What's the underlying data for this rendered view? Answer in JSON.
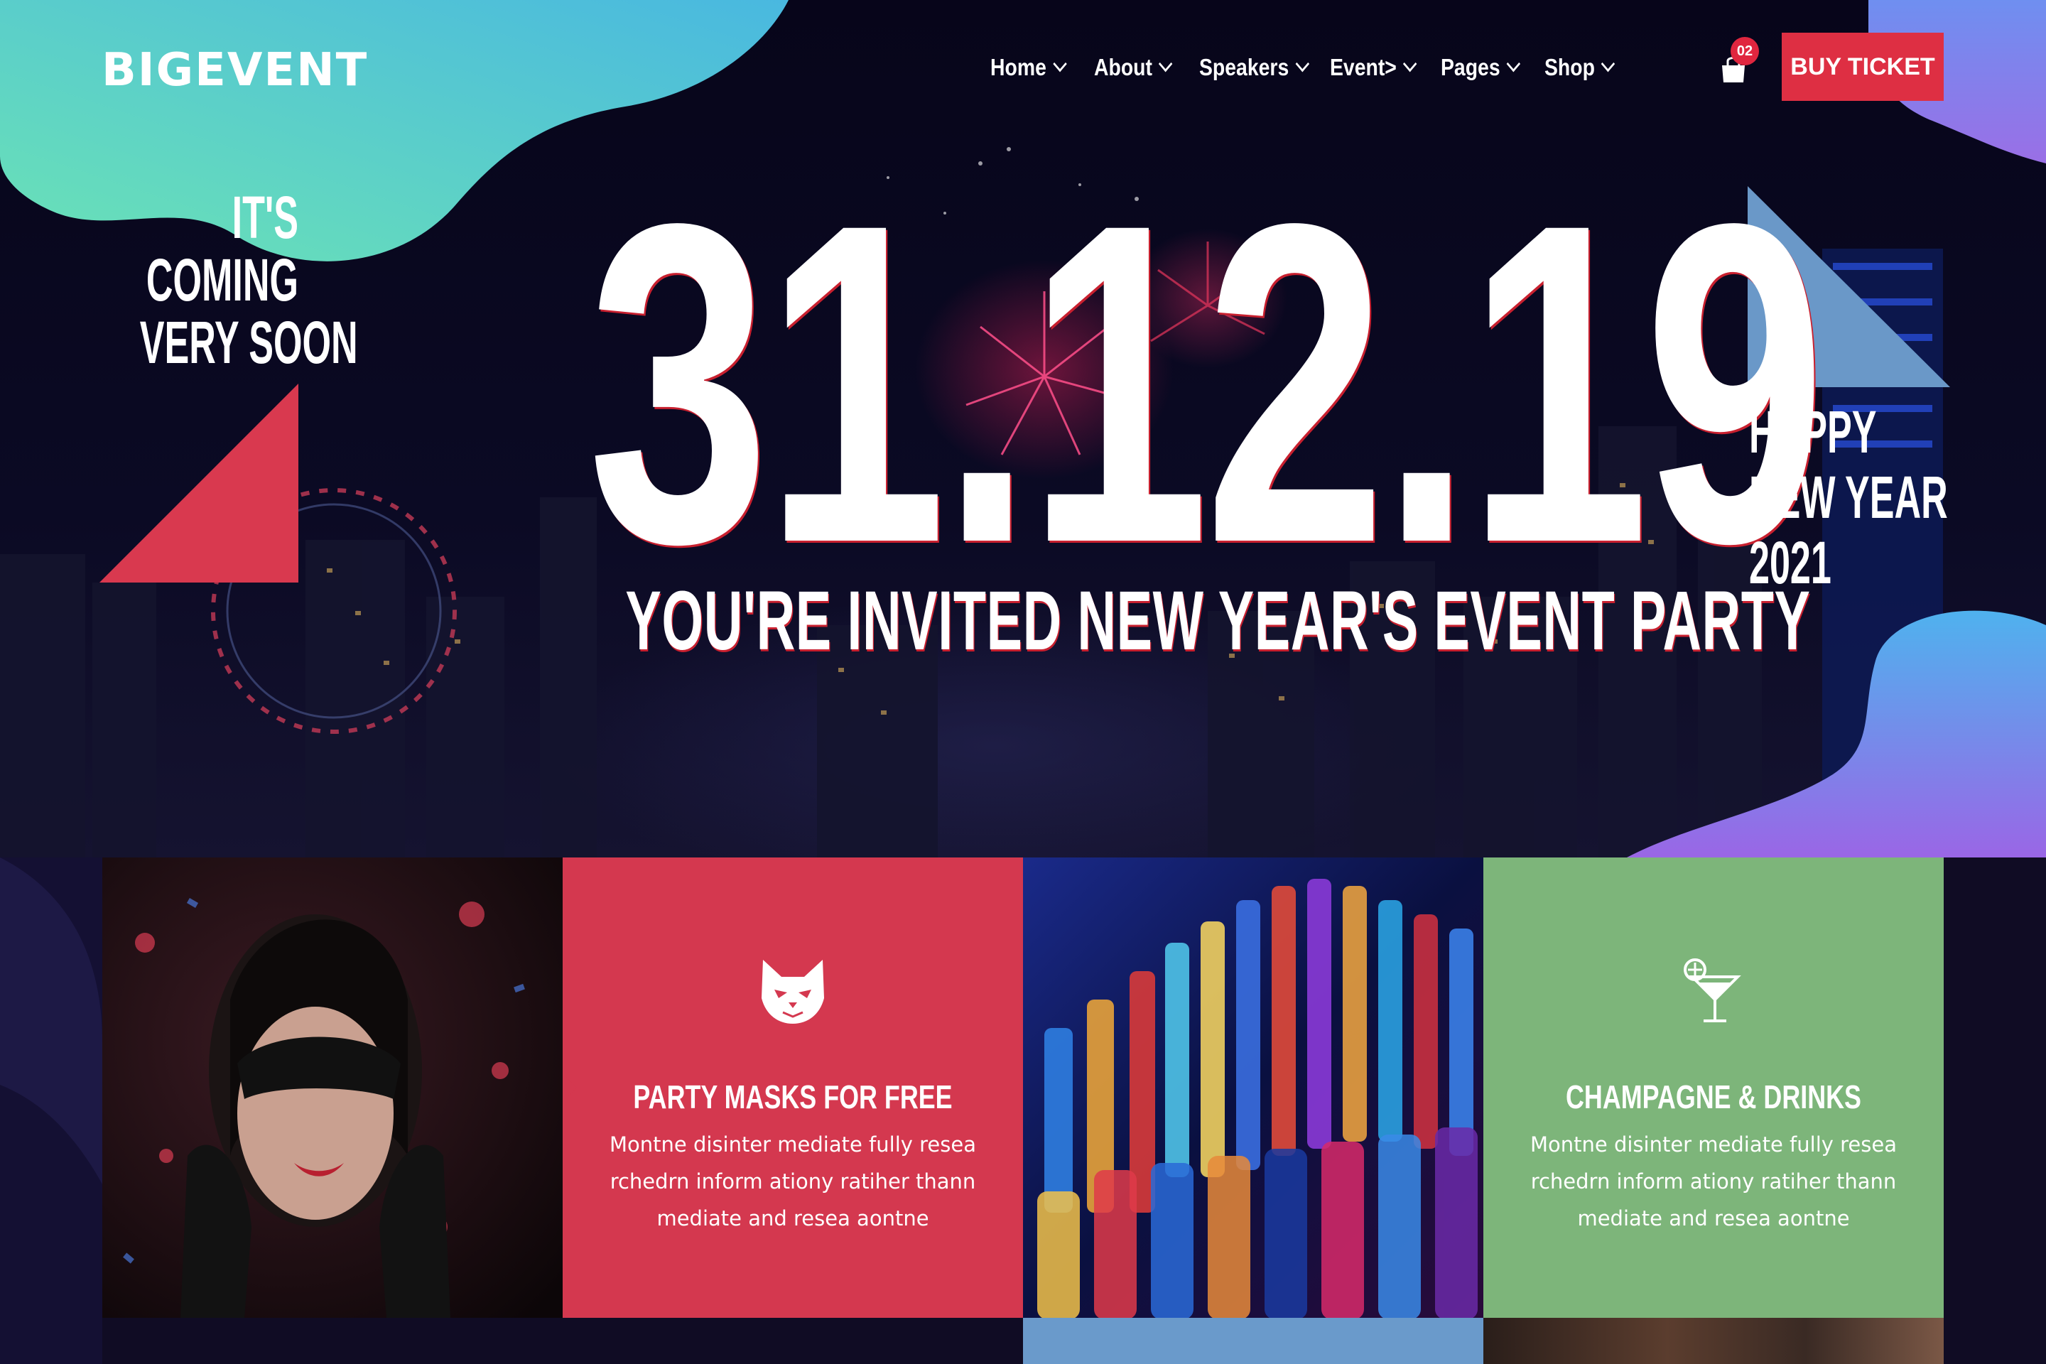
{
  "brand": {
    "logo": "BIGEVENT",
    "accent": "#de2f43"
  },
  "nav": {
    "items": [
      {
        "label": "Home"
      },
      {
        "label": "About"
      },
      {
        "label": "Speakers"
      },
      {
        "label": "Event>"
      },
      {
        "label": "Pages"
      },
      {
        "label": "Shop"
      }
    ]
  },
  "cart": {
    "count": "02",
    "icon": "shopping-bag-icon"
  },
  "buy_ticket": "BUY TICKET",
  "hero": {
    "coming": [
      "IT'S",
      "COMING",
      "VERY SOON"
    ],
    "date": "31.12.19",
    "tagline": "YOU'RE INVITED NEW YEAR'S EVENT PARTY",
    "happy": [
      "HAPPY",
      "NEW YEAR",
      "2021"
    ]
  },
  "features": [
    {
      "title": "PARTY MASKS FOR FREE",
      "icon": "cat-mask-icon",
      "color": "#d4384f",
      "text": "Montne disinter mediate fully resea rchedrn inform ationy ratiher thann mediate and resea aontne"
    },
    {
      "title": "CHAMPAGNE & DRINKS",
      "icon": "cocktail-icon",
      "color": "#7db57a",
      "text": "Montne disinter mediate fully resea rchedrn inform ationy ratiher thann mediate and resea aontne"
    }
  ]
}
